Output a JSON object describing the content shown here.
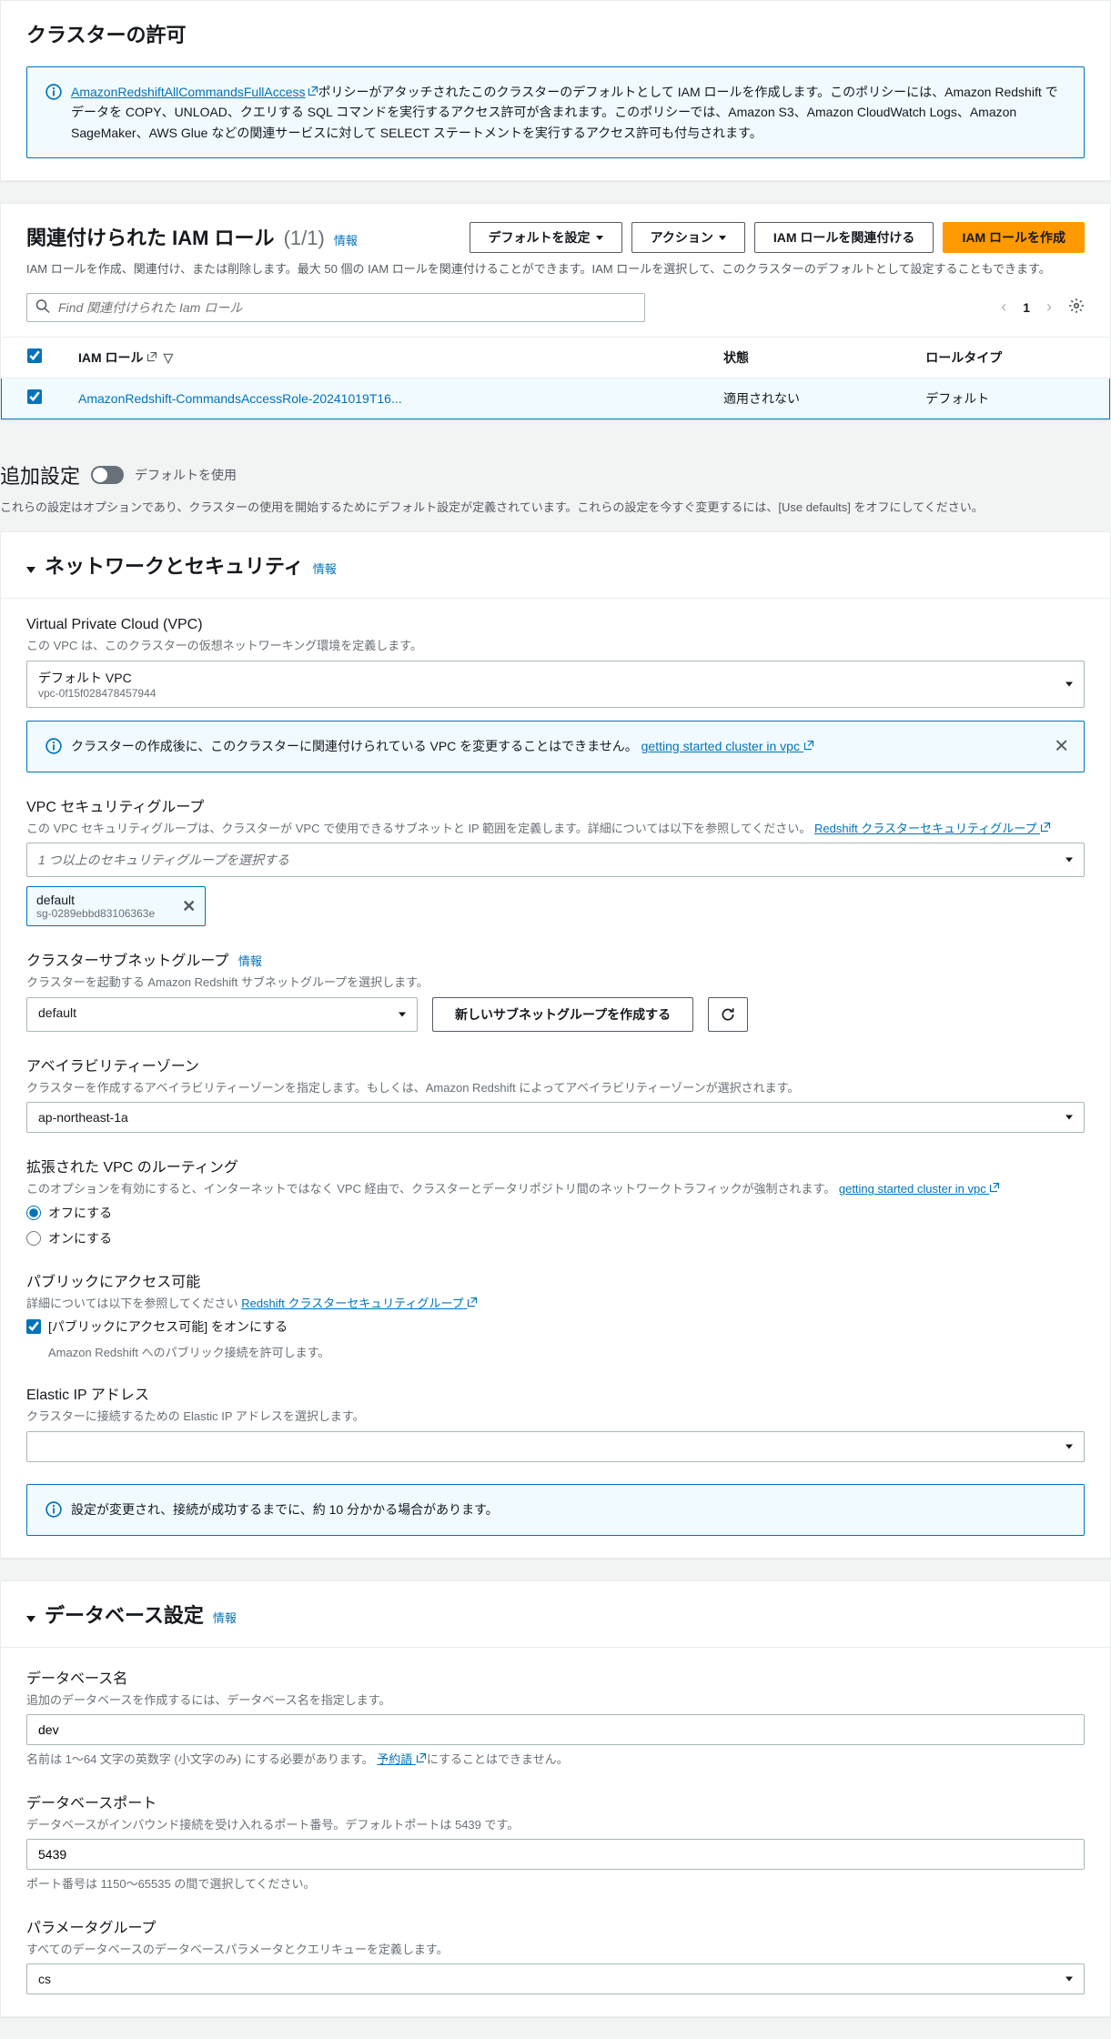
{
  "cluster_perm": {
    "title": "クラスターの許可",
    "info_link": "AmazonRedshiftAllCommandsFullAccess",
    "info_text": "ポリシーがアタッチされたこのクラスターのデフォルトとして IAM ロールを作成します。このポリシーには、Amazon Redshift でデータを COPY、UNLOAD、クエリする SQL コマンドを実行するアクセス許可が含まれます。このポリシーでは、Amazon S3、Amazon CloudWatch Logs、Amazon SageMaker、AWS Glue などの関連サービスに対して SELECT ステートメントを実行するアクセス許可も付与されます。"
  },
  "iam_roles": {
    "title": "関連付けられた IAM ロール",
    "count": "(1/1)",
    "info": "情報",
    "btn_default": "デフォルトを設定",
    "btn_action": "アクション",
    "btn_assoc": "IAM ロールを関連付ける",
    "btn_create": "IAM ロールを作成",
    "desc": "IAM ロールを作成、関連付け、または削除します。最大 50 個の IAM ロールを関連付けることができます。IAM ロールを選択して、このクラスターのデフォルトとして設定することもできます。",
    "search_placeholder": "Find 関連付けられた Iam ロール",
    "page": "1",
    "col_role": "IAM ロール",
    "col_state": "状態",
    "col_type": "ロールタイプ",
    "row": {
      "name": "AmazonRedshift-CommandsAccessRole-20241019T16...",
      "state": "適用されない",
      "type": "デフォルト"
    }
  },
  "extra": {
    "title": "追加設定",
    "toggle_label": "デフォルトを使用",
    "desc": "これらの設定はオプションであり、クラスターの使用を開始するためにデフォルト設定が定義されています。これらの設定を今すぐ変更するには、[Use defaults] をオフにしてください。"
  },
  "network": {
    "title": "ネットワークとセキュリティ",
    "info": "情報",
    "vpc": {
      "label": "Virtual Private Cloud (VPC)",
      "hint": "この VPC は、このクラスターの仮想ネットワーキング環境を定義します。",
      "value": "デフォルト VPC",
      "sub": "vpc-0f15f028478457944",
      "alert": "クラスターの作成後に、このクラスターに関連付けられている VPC を変更することはできません。",
      "alert_link": "getting started cluster in vpc"
    },
    "sg": {
      "label": "VPC セキュリティグループ",
      "hint": "この VPC セキュリティグループは、クラスターが VPC で使用できるサブネットと IP 範囲を定義します。詳細については以下を参照してください。",
      "hint_link": "Redshift クラスターセキュリティグループ",
      "placeholder": "1 つ以上のセキュリティグループを選択する",
      "chip": "default",
      "chip_sub": "sg-0289ebbd83106363e"
    },
    "subnet": {
      "label": "クラスターサブネットグループ",
      "info": "情報",
      "hint": "クラスターを起動する Amazon Redshift サブネットグループを選択します。",
      "value": "default",
      "btn_new": "新しいサブネットグループを作成する"
    },
    "az": {
      "label": "アベイラビリティーゾーン",
      "hint": "クラスターを作成するアベイラビリティーゾーンを指定します。もしくは、Amazon Redshift によってアベイラビリティーゾーンが選択されます。",
      "value": "ap-northeast-1a"
    },
    "routing": {
      "label": "拡張された VPC のルーティング",
      "hint": "このオプションを有効にすると、インターネットではなく VPC 経由で、クラスターとデータリポジトリ間のネットワークトラフィックが強制されます。",
      "hint_link": "getting started cluster in vpc",
      "off": "オフにする",
      "on": "オンにする"
    },
    "public": {
      "label": "パブリックにアクセス可能",
      "hint": "詳細については以下を参照してください",
      "hint_link": "Redshift クラスターセキュリティグループ",
      "check": "[パブリックにアクセス可能] をオンにする",
      "sub": "Amazon Redshift へのパブリック接続を許可します。"
    },
    "eip": {
      "label": "Elastic IP アドレス",
      "hint": "クラスターに接続するための Elastic IP アドレスを選択します。"
    },
    "alert_bottom": "設定が変更され、接続が成功するまでに、約 10 分かかる場合があります。"
  },
  "db": {
    "title": "データベース設定",
    "info": "情報",
    "name": {
      "label": "データベース名",
      "hint": "追加のデータベースを作成するには、データベース名を指定します。",
      "value": "dev",
      "below": "名前は 1〜64 文字の英数字 (小文字のみ) にする必要があります。",
      "below_link": "予約語",
      "below_after": "にすることはできません。"
    },
    "port": {
      "label": "データベースポート",
      "hint": "データベースがインバウンド接続を受け入れるポート番号。デフォルトポートは 5439 です。",
      "value": "5439",
      "below": "ポート番号は 1150〜65535 の間で選択してください。"
    },
    "pg": {
      "label": "パラメータグループ",
      "hint": "すべてのデータベースのデータベースパラメータとクエリキューを定義します。",
      "value": "cs"
    }
  }
}
